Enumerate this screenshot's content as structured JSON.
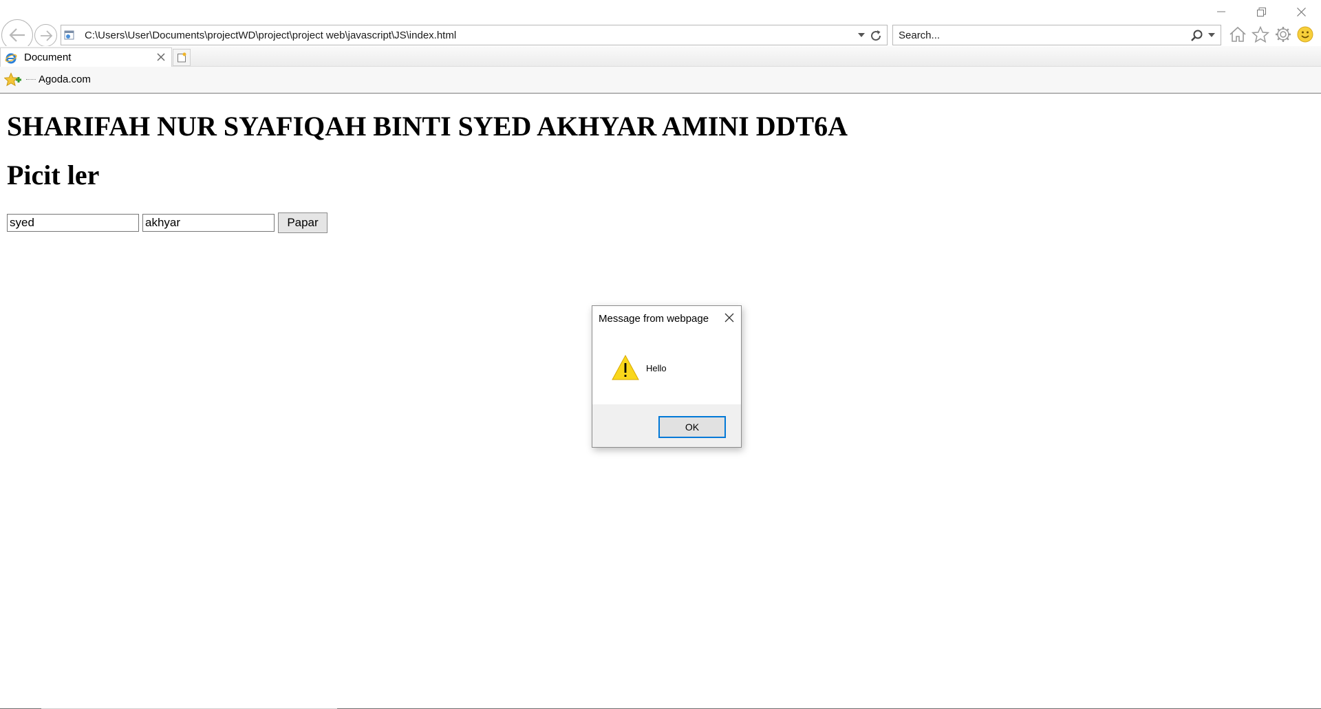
{
  "browser": {
    "address_url": "C:\\Users\\User\\Documents\\projectWD\\project\\project web\\javascript\\JS\\index.html",
    "search_placeholder": "Search...",
    "tab_title": "Document",
    "favorites": [
      {
        "label": "Agoda.com"
      }
    ],
    "icons": {
      "back": "back-arrow-icon",
      "forward": "forward-arrow-icon",
      "refresh": "refresh-icon",
      "search": "magnifier-icon",
      "home": "home-icon",
      "favorites": "star-icon",
      "tools": "gear-icon",
      "feedback": "smiley-icon"
    }
  },
  "page": {
    "heading1": "SHARIFAH NUR SYAFIQAH BINTI SYED AKHYAR AMINI DDT6A",
    "heading2": "Picit ler",
    "input1_value": "syed",
    "input2_value": "akhyar",
    "button_label": "Papar"
  },
  "dialog": {
    "title": "Message from webpage",
    "message": "Hello",
    "ok_label": "OK",
    "icon": "warning-icon"
  },
  "colors": {
    "accent": "#0078d7",
    "warning": "#f9d71c"
  }
}
